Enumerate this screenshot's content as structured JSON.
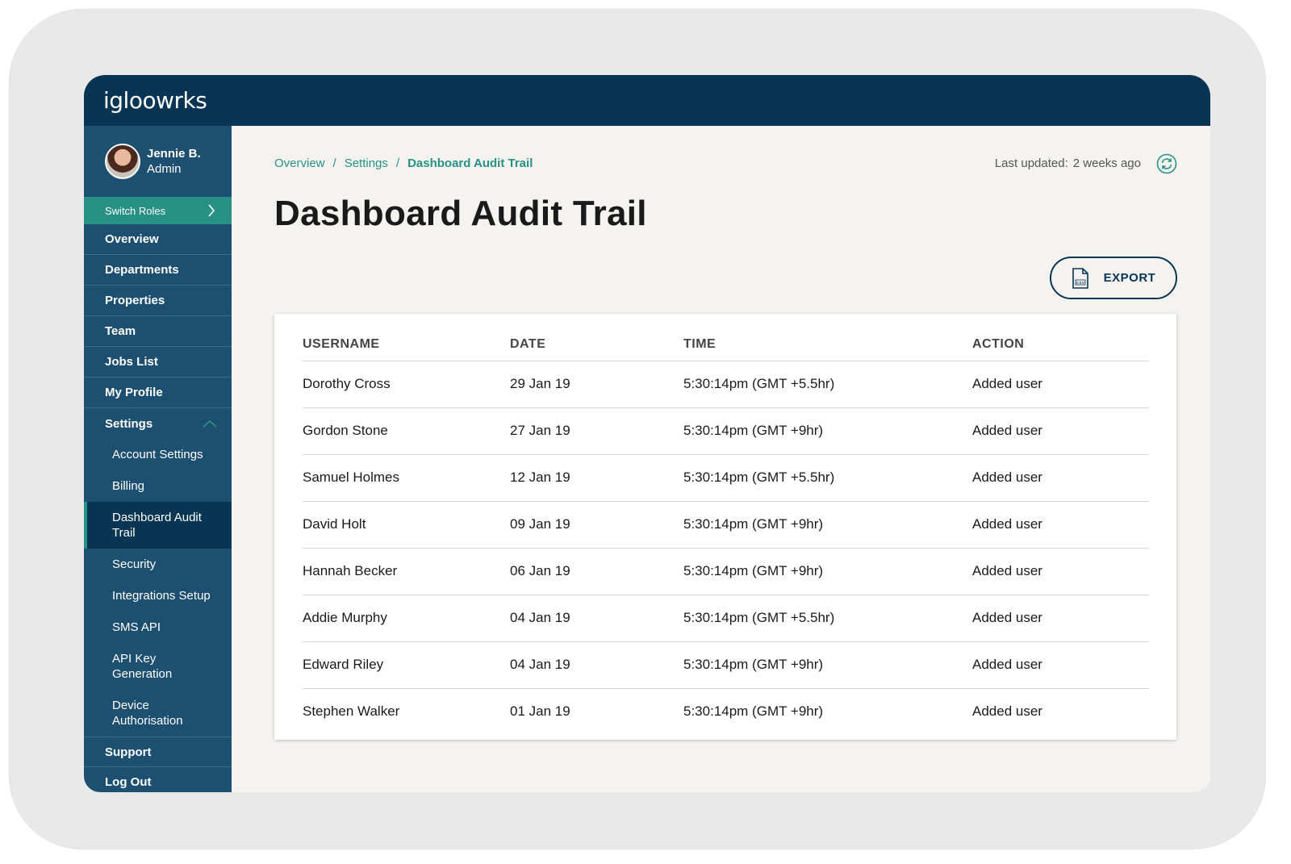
{
  "app": {
    "logo": "igloowrks"
  },
  "user": {
    "name": "Jennie B.",
    "role": "Admin"
  },
  "sidebar": {
    "switch_roles": "Switch Roles",
    "items": [
      {
        "label": "Overview"
      },
      {
        "label": "Departments"
      },
      {
        "label": "Properties"
      },
      {
        "label": "Team"
      },
      {
        "label": "Jobs List"
      },
      {
        "label": "My Profile"
      },
      {
        "label": "Settings"
      }
    ],
    "settings_sub": [
      {
        "label": "Account Settings"
      },
      {
        "label": "Billing"
      },
      {
        "label": "Dashboard Audit Trail"
      },
      {
        "label": "Security"
      },
      {
        "label": "Integrations Setup"
      },
      {
        "label": "SMS API"
      },
      {
        "label": "API Key Generation"
      },
      {
        "label": "Device Authorisation"
      }
    ],
    "bottom_items": [
      {
        "label": "Support"
      },
      {
        "label": "Log Out"
      }
    ]
  },
  "breadcrumb": {
    "items": [
      "Overview",
      "Settings",
      "Dashboard Audit Trail"
    ],
    "separator": "/"
  },
  "header": {
    "last_updated_label": "Last updated:",
    "last_updated_value": "2 weeks ago",
    "title": "Dashboard Audit Trail"
  },
  "export": {
    "label": "EXPORT",
    "icon": "csv-file-icon"
  },
  "table": {
    "columns": [
      "USERNAME",
      "DATE",
      "TIME",
      "ACTION"
    ],
    "rows": [
      [
        "Dorothy Cross",
        "29 Jan 19",
        "5:30:14pm (GMT +5.5hr)",
        "Added user"
      ],
      [
        "Gordon Stone",
        "27 Jan 19",
        "5:30:14pm (GMT +9hr)",
        "Added user"
      ],
      [
        "Samuel Holmes",
        "12 Jan 19",
        "5:30:14pm (GMT +5.5hr)",
        "Added user"
      ],
      [
        "David Holt",
        "09 Jan 19",
        "5:30:14pm (GMT +9hr)",
        "Added user"
      ],
      [
        "Hannah Becker",
        "06 Jan 19",
        "5:30:14pm (GMT +9hr)",
        "Added user"
      ],
      [
        "Addie Murphy",
        "04 Jan 19",
        "5:30:14pm (GMT +5.5hr)",
        "Added user"
      ],
      [
        "Edward Riley",
        "04 Jan 19",
        "5:30:14pm (GMT +9hr)",
        "Added user"
      ],
      [
        "Stephen Walker",
        "01 Jan 19",
        "5:30:14pm (GMT +9hr)",
        "Added user"
      ]
    ]
  },
  "colors": {
    "navy": "#083554",
    "sidebar": "#1d4f70",
    "teal": "#279185",
    "background": "#f5f3ef"
  }
}
